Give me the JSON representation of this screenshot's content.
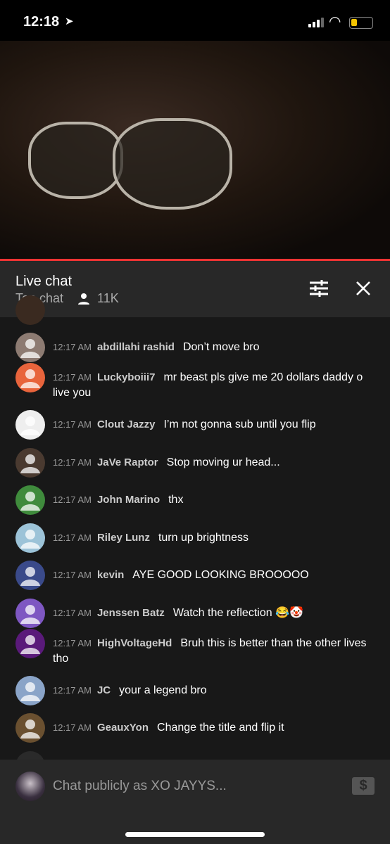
{
  "status_bar": {
    "time": "12:18"
  },
  "header": {
    "title": "Live chat",
    "mode": "Top chat",
    "viewers": "11K"
  },
  "messages": [
    {
      "time": "12:17 AM",
      "author": "abdillahi rashid",
      "text": "Don’t move bro",
      "avatar_color": "#8d7b72"
    },
    {
      "time": "12:17 AM",
      "author": "Luckyboiii7",
      "text": "mr beast pls give me 20 dollars daddy o live you",
      "avatar_color": "#e8643c"
    },
    {
      "time": "12:17 AM",
      "author": "Clout Jazzy",
      "text": "I’m not gonna sub until you flip",
      "avatar_color": "#eeeeee"
    },
    {
      "time": "12:17 AM",
      "author": "JaVe Raptor",
      "text": "Stop moving ur head...",
      "avatar_color": "#4a3a30"
    },
    {
      "time": "12:17 AM",
      "author": "John Marino",
      "text": "thx",
      "avatar_color": "#3f8b3c"
    },
    {
      "time": "12:17 AM",
      "author": "Riley Lunz",
      "text": "turn up brightness",
      "avatar_color": "#9cc3d8"
    },
    {
      "time": "12:17 AM",
      "author": "kevin",
      "text": "AYE GOOD LOOKING BROOOOO",
      "avatar_color": "#3a4a8a"
    },
    {
      "time": "12:17 AM",
      "author": "Jenssen Batz",
      "text": "Watch the reflection 😂🤡",
      "avatar_color": "#7e57c2"
    },
    {
      "time": "12:17 AM",
      "author": "HighVoltageHd",
      "text": "Bruh this is better than the other lives tho",
      "avatar_color": "#5a1a7a"
    },
    {
      "time": "12:17 AM",
      "author": "JC",
      "text": "your a legend bro",
      "avatar_color": "#8aa4c8"
    },
    {
      "time": "12:17 AM",
      "author": "GeauxYon",
      "text": "Change the title and flip it",
      "avatar_color": "#6a5030"
    }
  ],
  "input": {
    "placeholder": "Chat publicly as XO JAYYS..."
  },
  "icons": {
    "filter": "sliders-icon",
    "close": "close-icon",
    "super_chat": "dollar-icon",
    "viewers": "person-icon"
  }
}
